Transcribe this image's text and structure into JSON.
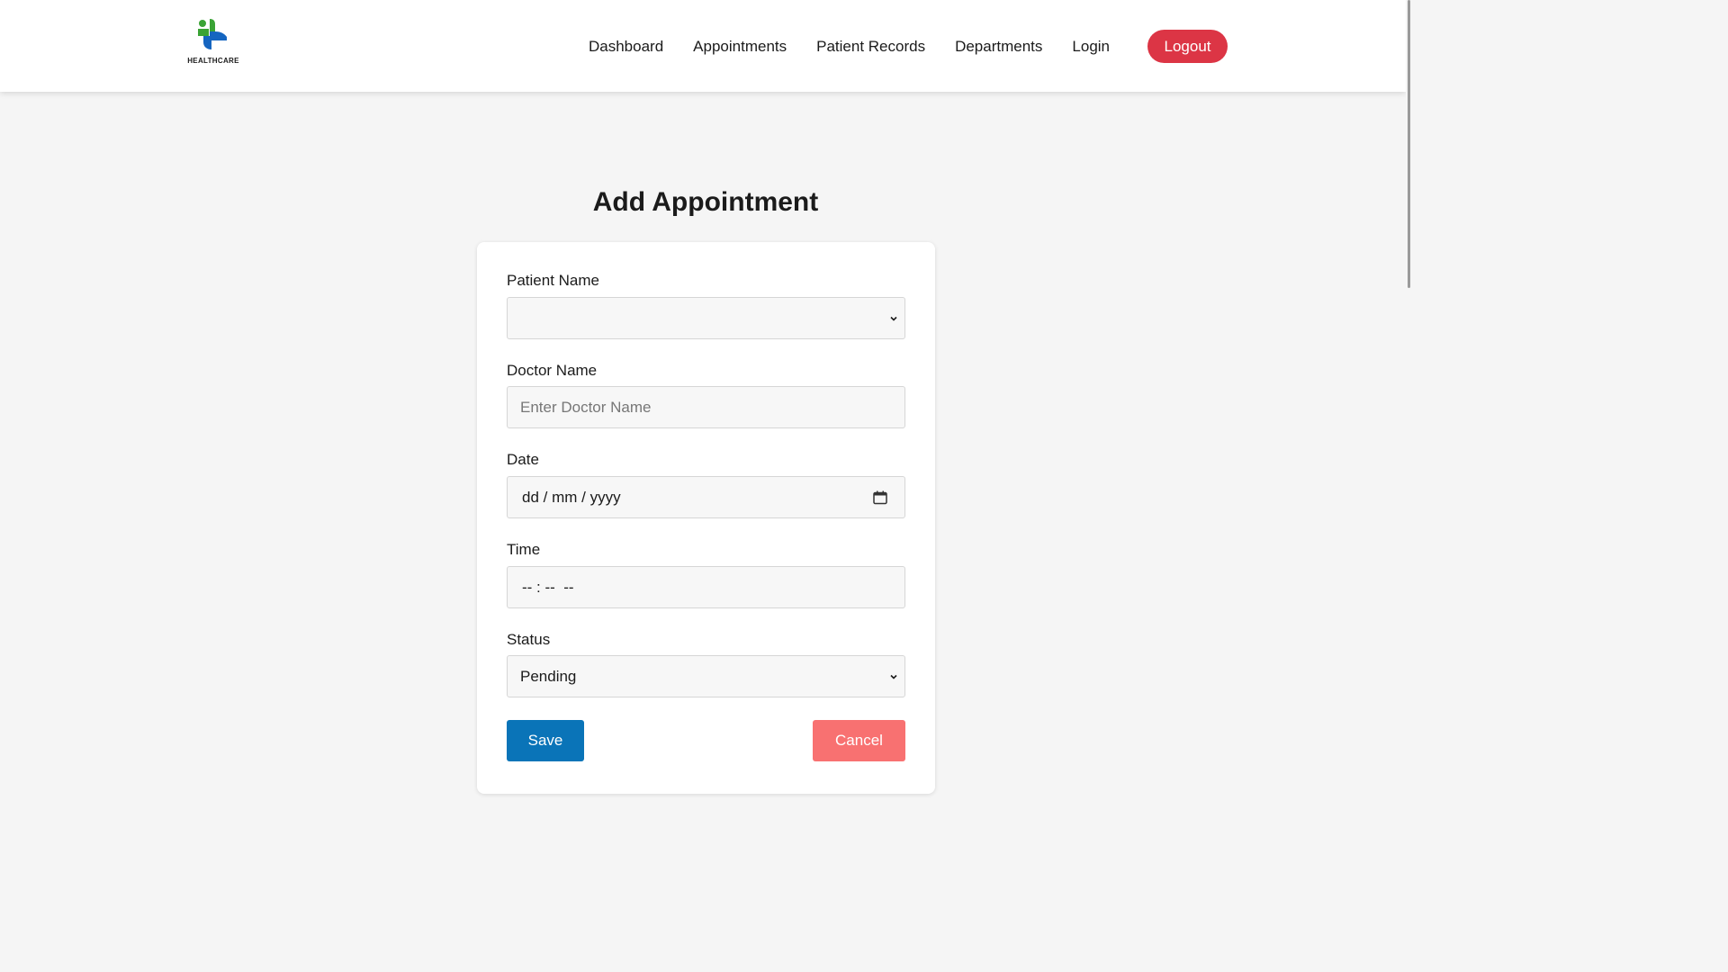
{
  "brand": {
    "logo_text": "HEALTHCARE",
    "colors": {
      "green": "#3aa335",
      "blue": "#1565c0"
    }
  },
  "nav": {
    "links": [
      "Dashboard",
      "Appointments",
      "Patient Records",
      "Departments",
      "Login"
    ],
    "logout_label": "Logout",
    "logout_color": "#dc3545"
  },
  "page": {
    "title": "Add Appointment"
  },
  "form": {
    "patient_name": {
      "label": "Patient Name",
      "value": ""
    },
    "doctor_name": {
      "label": "Doctor Name",
      "placeholder": "Enter Doctor Name"
    },
    "date": {
      "label": "Date",
      "placeholder": "dd / mm / yyyy",
      "icon": "calendar-icon"
    },
    "time": {
      "label": "Time",
      "placeholder": "-- : --  --"
    },
    "status": {
      "label": "Status",
      "value": "Pending"
    },
    "save_label": "Save",
    "cancel_label": "Cancel",
    "save_color": "#0a74b8",
    "cancel_color": "#f87171"
  }
}
